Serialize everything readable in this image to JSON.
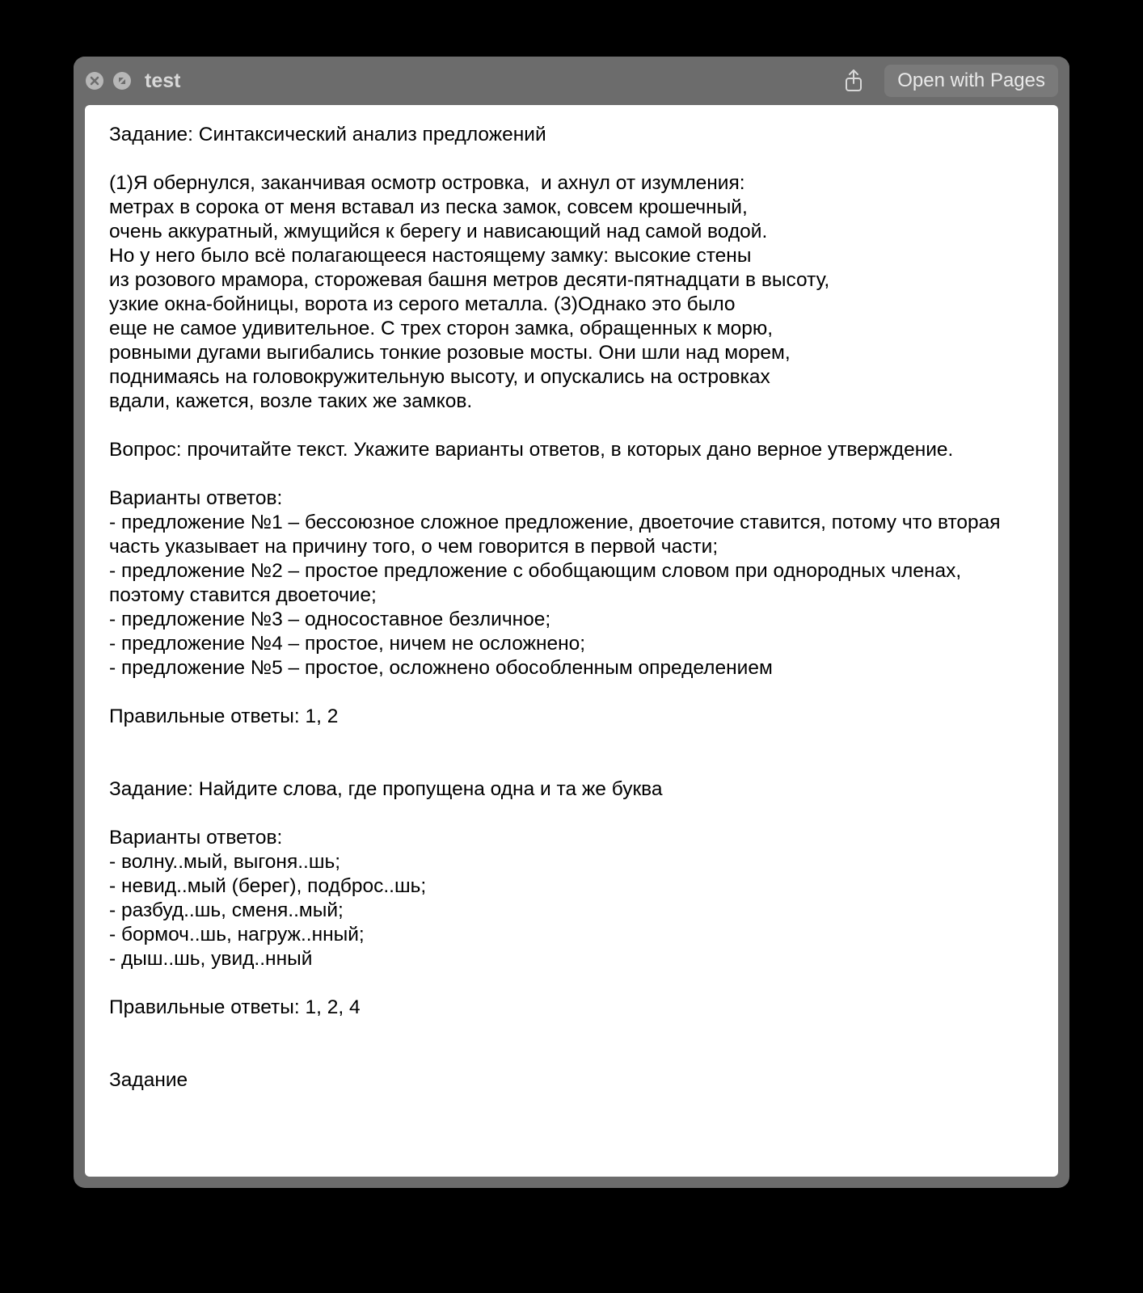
{
  "window": {
    "title": "test",
    "open_button": "Open with Pages"
  },
  "doc": {
    "task1_title": "Задание: Синтаксический анализ предложений",
    "task1_text": "(1)Я обернулся, заканчивая осмотр островка,  и ахнул от изумления:\nметрах в сорока от меня вставал из песка замок, совсем крошечный,\nочень аккуратный, жмущийся к берегу и нависающий над самой водой.\nНо у него было всё полагающееся настоящему замку: высокие стены\nиз розового мрамора, сторожевая башня метров десяти-пятнадцати в высоту,\nузкие окна-бойницы, ворота из серого металла. (3)Однако это было\nеще не самое удивительное. С трех сторон замка, обращенных к морю,\nровными дугами выгибались тонкие розовые мосты. Они шли над морем,\nподнимаясь на головокружительную высоту, и опускались на островках\nвдали, кажется, возле таких же замков.",
    "task1_question": "Вопрос: прочитайте текст. Укажите варианты ответов, в которых дано верное утверждение.",
    "task1_options_header": "Варианты ответов:",
    "task1_options": "- предложение №1 – бессоюзное сложное предложение, двоеточие ставится, потому что вторая часть указывает на причину того, о чем говорится в первой части;\n- предложение №2 – простое предложение с обобщающим словом при однородных членах, поэтому ставится двоеточие;\n- предложение №3 – односоставное безличное;\n- предложение №4 – простое, ничем не осложнено;\n- предложение №5 – простое, осложнено обособленным определением",
    "task1_answers": "Правильные ответы: 1, 2",
    "task2_title": "Задание: Найдите слова, где пропущена одна и та же буква",
    "task2_options_header": "Варианты ответов:",
    "task2_options": "- волну..мый, выгоня..шь;\n- невид..мый (берег), подброс..шь;\n- разбуд..шь, сменя..мый;\n- бормоч..шь, нагруж..нный;\n- дыш..шь, увид..нный",
    "task2_answers": "Правильные ответы: 1, 2, 4",
    "task3_title": "Задание"
  }
}
